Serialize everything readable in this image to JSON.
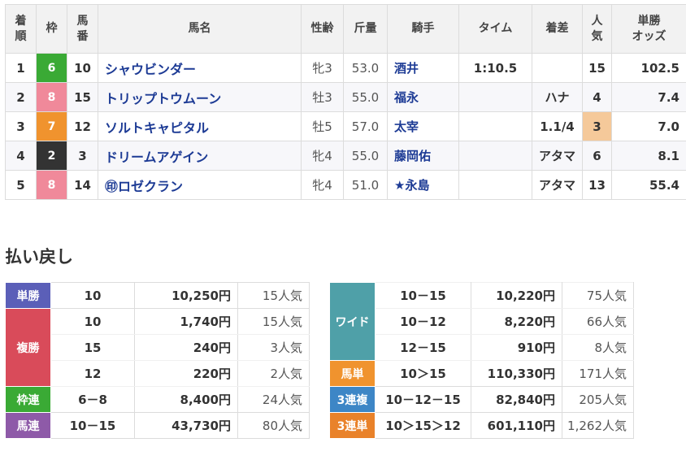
{
  "header": {
    "rank": "着\n順",
    "waku": "枠",
    "num": "馬\n番",
    "name": "馬名",
    "sex_age": "性齢",
    "weight": "斤量",
    "jockey": "騎手",
    "time": "タイム",
    "margin": "着差",
    "popularity": "人\n気",
    "odds": "単勝\nオッズ"
  },
  "results": [
    {
      "rank": "1",
      "waku": "6",
      "waku_color": "#3aaa35",
      "num": "10",
      "name": "シャウビンダー",
      "sex_age": "牝3",
      "weight": "53.0",
      "jockey": "酒井",
      "time": "1:10.5",
      "margin": "",
      "popularity": "15",
      "odds": "102.5"
    },
    {
      "rank": "2",
      "waku": "8",
      "waku_color": "#f0899a",
      "num": "15",
      "name": "トリップトウムーン",
      "sex_age": "牡3",
      "weight": "55.0",
      "jockey": "福永",
      "time": "",
      "margin": "ハナ",
      "popularity": "4",
      "odds": "7.4"
    },
    {
      "rank": "3",
      "waku": "7",
      "waku_color": "#f0932e",
      "num": "12",
      "name": "ソルトキャピタル",
      "sex_age": "牡5",
      "weight": "57.0",
      "jockey": "太宰",
      "time": "",
      "margin": "1.1/4",
      "popularity": "3",
      "odds": "7.0"
    },
    {
      "rank": "4",
      "waku": "2",
      "waku_color": "#333333",
      "num": "3",
      "name": "ドリームアゲイン",
      "sex_age": "牝4",
      "weight": "55.0",
      "jockey": "藤岡佑",
      "time": "",
      "margin": "アタマ",
      "popularity": "6",
      "odds": "8.1"
    },
    {
      "rank": "5",
      "waku": "8",
      "waku_color": "#f0899a",
      "num": "14",
      "name": "㊞ロゼクラン",
      "sex_age": "牝4",
      "weight": "51.0",
      "jockey": "★永島",
      "time": "",
      "margin": "アタマ",
      "popularity": "13",
      "odds": "55.4"
    }
  ],
  "payout": {
    "heading": "払い戻し",
    "left": [
      {
        "label": "単勝",
        "color": "#5b5fb8",
        "rows": [
          {
            "comb": "10",
            "amount": "10,250円",
            "pop": "15人気"
          }
        ]
      },
      {
        "label": "複勝",
        "color": "#d94b5a",
        "rows": [
          {
            "comb": "10",
            "amount": "1,740円",
            "pop": "15人気"
          },
          {
            "comb": "15",
            "amount": "240円",
            "pop": "3人気"
          },
          {
            "comb": "12",
            "amount": "220円",
            "pop": "2人気"
          }
        ]
      },
      {
        "label": "枠連",
        "color": "#3aaa35",
        "rows": [
          {
            "comb": "6－8",
            "amount": "8,400円",
            "pop": "24人気"
          }
        ]
      },
      {
        "label": "馬連",
        "color": "#8e5aa8",
        "rows": [
          {
            "comb": "10－15",
            "amount": "43,730円",
            "pop": "80人気"
          }
        ]
      }
    ],
    "right": [
      {
        "label": "ワイド",
        "color": "#4fa0a8",
        "rows": [
          {
            "comb": "10－15",
            "amount": "10,220円",
            "pop": "75人気"
          },
          {
            "comb": "10－12",
            "amount": "8,220円",
            "pop": "66人気"
          },
          {
            "comb": "12－15",
            "amount": "910円",
            "pop": "8人気"
          }
        ]
      },
      {
        "label": "馬単",
        "color": "#f0932e",
        "rows": [
          {
            "comb": "10＞15",
            "amount": "110,330円",
            "pop": "171人気"
          }
        ]
      },
      {
        "label": "3連複",
        "color": "#3d86c6",
        "rows": [
          {
            "comb": "10－12－15",
            "amount": "82,840円",
            "pop": "205人気"
          }
        ]
      },
      {
        "label": "3連単",
        "color": "#e9822a",
        "rows": [
          {
            "comb": "10＞15＞12",
            "amount": "601,110円",
            "pop": "1,262人気"
          }
        ]
      }
    ]
  }
}
